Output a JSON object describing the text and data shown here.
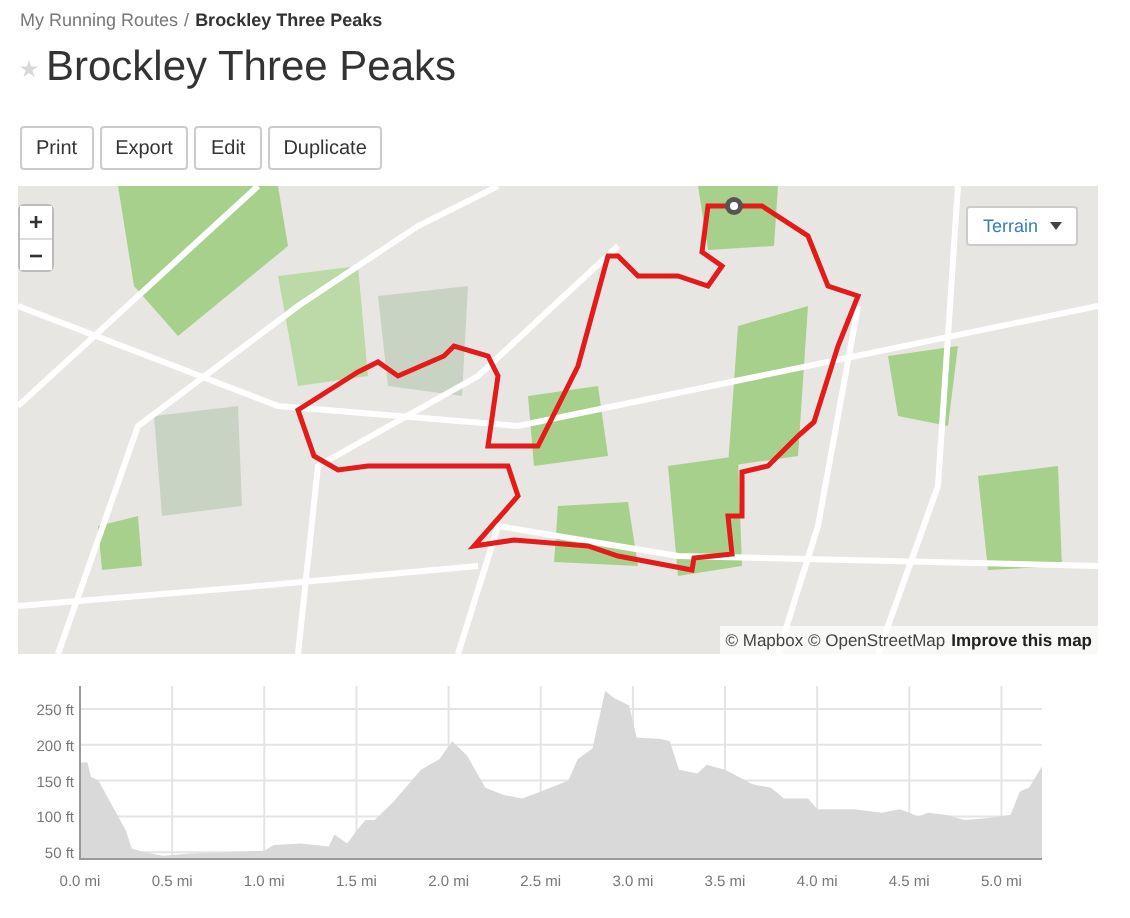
{
  "breadcrumb": {
    "parent": "My Running Routes",
    "separator": "/",
    "current": "Brockley Three Peaks"
  },
  "title": "Brockley Three Peaks",
  "favorite": {
    "on": false
  },
  "buttons": [
    "Print",
    "Export",
    "Edit",
    "Duplicate"
  ],
  "map": {
    "zoom_in": "+",
    "zoom_out": "−",
    "layer": "Terrain",
    "attribution": "© Mapbox © OpenStreetMap",
    "improve_link": "Improve this map"
  },
  "elevation": {
    "chart_data": {
      "type": "area",
      "grid": true,
      "xlim": [
        0,
        5.22
      ],
      "ylim": [
        42,
        282
      ],
      "xticks": [
        {
          "value": 0,
          "label": "0.0 mi"
        },
        {
          "value": 0.5,
          "label": "0.5 mi"
        },
        {
          "value": 1,
          "label": "1.0 mi"
        },
        {
          "value": 1.5,
          "label": "1.5 mi"
        },
        {
          "value": 2,
          "label": "2.0 mi"
        },
        {
          "value": 2.5,
          "label": "2.5 mi"
        },
        {
          "value": 3,
          "label": "3.0 mi"
        },
        {
          "value": 3.5,
          "label": "3.5 mi"
        },
        {
          "value": 4,
          "label": "4.0 mi"
        },
        {
          "value": 4.5,
          "label": "4.5 mi"
        },
        {
          "value": 5,
          "label": "5.0 mi"
        }
      ],
      "yticks": [
        {
          "value": 50,
          "label": "50 ft"
        },
        {
          "value": 100,
          "label": "100 ft"
        },
        {
          "value": 150,
          "label": "150 ft"
        },
        {
          "value": 200,
          "label": "200 ft"
        },
        {
          "value": 250,
          "label": "250 ft"
        }
      ],
      "x": [
        0,
        0.04,
        0.06,
        0.1,
        0.25,
        0.28,
        0.35,
        0.45,
        0.6,
        1,
        1.05,
        1.2,
        1.35,
        1.38,
        1.45,
        1.5,
        1.55,
        1.6,
        1.7,
        1.8,
        1.85,
        1.95,
        2.02,
        2.1,
        2.2,
        2.3,
        2.4,
        2.5,
        2.65,
        2.7,
        2.78,
        2.85,
        2.9,
        2.98,
        3.02,
        3.15,
        3.2,
        3.25,
        3.35,
        3.4,
        3.5,
        3.65,
        3.75,
        3.82,
        3.95,
        4,
        4.1,
        4.2,
        4.35,
        4.45,
        4.55,
        4.6,
        4.7,
        4.8,
        4.9,
        5.05,
        5.1,
        5.15,
        5.22
      ],
      "series": [
        {
          "color": "#d9d9d9",
          "values": [
            175,
            175,
            155,
            150,
            80,
            55,
            50,
            45,
            48,
            52,
            60,
            62,
            58,
            75,
            62,
            80,
            95,
            95,
            120,
            150,
            165,
            180,
            205,
            185,
            140,
            130,
            125,
            135,
            150,
            180,
            195,
            275,
            265,
            255,
            210,
            208,
            205,
            165,
            160,
            172,
            165,
            145,
            140,
            125,
            125,
            110,
            110,
            110,
            105,
            110,
            100,
            105,
            102,
            95,
            97,
            102,
            135,
            140,
            170
          ]
        }
      ]
    }
  }
}
